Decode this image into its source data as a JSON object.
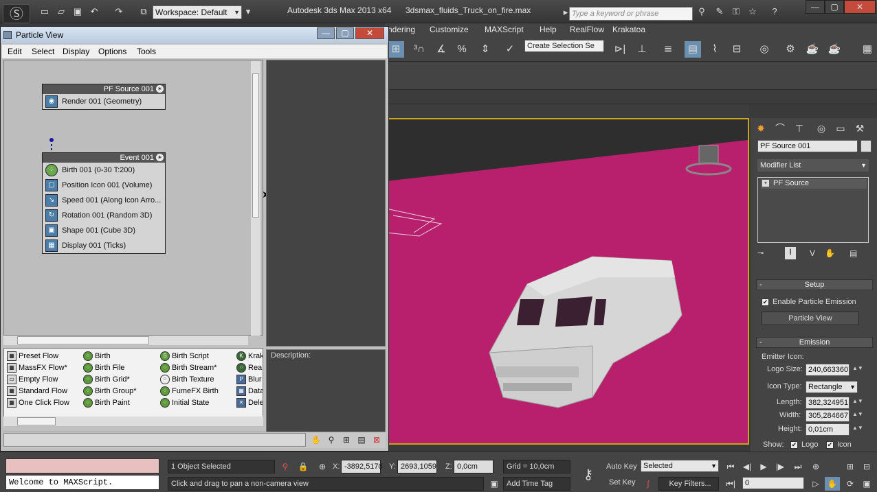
{
  "app": {
    "quick_access": [
      "new-icon",
      "open-icon",
      "save-icon",
      "undo-icon",
      "redo-icon",
      "project-folder-icon"
    ],
    "workspace": "Workspace: Default",
    "title": "Autodesk 3ds Max  2013 x64",
    "document": "3dsmax_fluids_Truck_on_fire.max",
    "search_placeholder": "Type a keyword or phrase"
  },
  "menubar": {
    "items": [
      "ndering",
      "Customize",
      "MAXScript",
      "Help",
      "RealFlow",
      "Krakatoa"
    ]
  },
  "toolbar": {
    "selection_set_placeholder": "Create Selection Se"
  },
  "particle_view": {
    "title": "Particle View",
    "menu": [
      "Edit",
      "Select",
      "Display",
      "Options",
      "Tools"
    ],
    "source_node": {
      "header": "PF Source 001",
      "operators": [
        "Render 001 (Geometry)"
      ]
    },
    "event_node": {
      "header": "Event 001",
      "operators": [
        "Birth 001 (0-30 T:200)",
        "Position Icon 001 (Volume)",
        "Speed 001 (Along Icon Arro...",
        "Rotation 001 (Random 3D)",
        "Shape 001 (Cube 3D)",
        "Display 001 (Ticks)"
      ]
    },
    "description_label": "Description:",
    "depot": {
      "col1": [
        "Preset Flow",
        "MassFX Flow*",
        "Empty Flow",
        "Standard Flow",
        "One Click Flow"
      ],
      "col2": [
        "Birth",
        "Birth File",
        "Birth Grid*",
        "Birth Group*",
        "Birth Paint"
      ],
      "col3": [
        "Birth Script",
        "Birth Stream*",
        "Birth Texture",
        "FumeFX Birth",
        "Initial State"
      ],
      "col4": [
        "Krak",
        "Rea",
        "Blur",
        "Data",
        "Dele"
      ]
    }
  },
  "command_panel": {
    "object_name": "PF Source 001",
    "modifier_list": "Modifier List",
    "stack_item": "PF Source",
    "setup": {
      "header": "Setup",
      "enable_emission": "Enable Particle Emission",
      "particle_view_btn": "Particle View"
    },
    "emission": {
      "header": "Emission",
      "emitter_icon": "Emitter Icon:",
      "logo_size_label": "Logo Size:",
      "logo_size": "240,663360",
      "icon_type_label": "Icon Type:",
      "icon_type": "Rectangle",
      "length_label": "Length:",
      "length": "382,324951",
      "width_label": "Width:",
      "width": "305,284667",
      "height_label": "Height:",
      "height": "0,01cm",
      "show_label": "Show:",
      "show_logo": "Logo",
      "show_icon": "Icon"
    }
  },
  "status": {
    "maxscript_out": "Welcome to MAXScript.",
    "selection": "1 Object Selected",
    "prompt": "Click and drag to pan a non-camera view",
    "x_label": "X:",
    "x": "-3892,5170",
    "y_label": "Y:",
    "y": "2693,1059",
    "z_label": "Z:",
    "z": "0,0cm",
    "grid": "Grid = 10,0cm",
    "add_time_tag": "Add Time Tag",
    "auto_key": "Auto Key",
    "set_key": "Set Key",
    "selected": "Selected",
    "key_filters": "Key Filters...",
    "frame": "0"
  },
  "colors": {
    "viewport_border": "#c9a418",
    "ground_plane": "#b8206e",
    "truck": "#d6d6d6"
  }
}
